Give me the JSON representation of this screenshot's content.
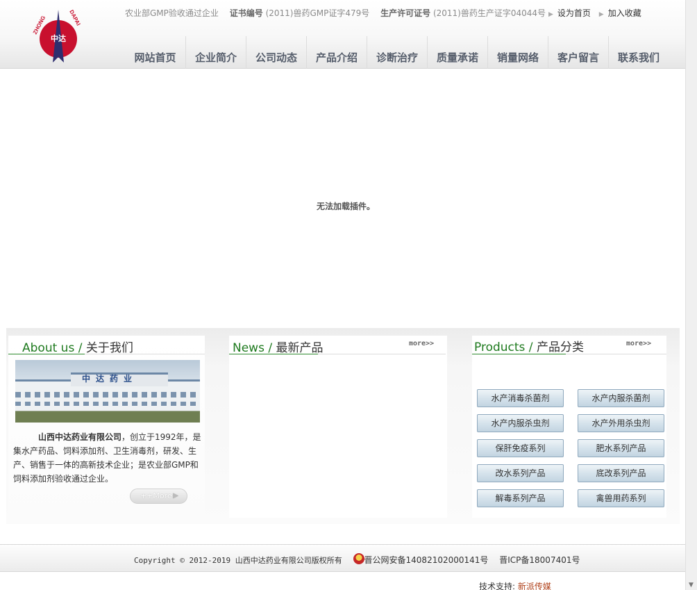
{
  "header": {
    "logo_letters": {
      "left": "ZHONG",
      "right": "DAPAI",
      "center": "中达"
    },
    "qualification": "农业部GMP验收通过企业",
    "cert_label": "证书编号",
    "cert_value": "(2011)兽药GMP证字479号",
    "license_label": "生产许可证号",
    "license_value": "(2011)兽药生产证字04044号",
    "set_home": "设为首页",
    "add_favorite": "加入收藏"
  },
  "nav": {
    "items": [
      "网站首页",
      "企业简介",
      "公司动态",
      "产品介绍",
      "诊断治疗",
      "质量承诺",
      "销量网络",
      "客户留言",
      "联系我们"
    ]
  },
  "plugin": {
    "message": "无法加载插件。"
  },
  "about": {
    "title_en": "About us /",
    "title_cn": "关于我们",
    "image_sign": "中达药业",
    "company_name": "山西中达药业有限公司",
    "description": "，创立于1992年，是集水产药品、饲料添加剂、卫生消毒剂，研发、生产、销售于一体的高新技术企业；是农业部GMP和饲料添加剂验收通过企业。",
    "more": "++More"
  },
  "news": {
    "title_en": "News /",
    "title_cn": "最新产品",
    "more": "more>>"
  },
  "products": {
    "title_en": "Products /",
    "title_cn": "产品分类",
    "more": "more>>",
    "items": [
      "水产消毒杀菌剂",
      "水产内服杀菌剂",
      "水产内服杀虫剂",
      "水产外用杀虫剂",
      "保肝免疫系列",
      "肥水系列产品",
      "改水系列产品",
      "底改系列产品",
      "解毒系列产品",
      "禽兽用药系列"
    ]
  },
  "footer": {
    "copyright": "Copyright © 2012-2019 山西中达药业有限公司版权所有",
    "police": "晋公网安备14082102000141号",
    "icp": "晋ICP备18007401号",
    "tech_label": "技术支持:",
    "tech_link": "新派传媒"
  },
  "colors": {
    "accent_green": "#2c8a2c",
    "nav_text": "#555d6b",
    "logo_red": "#c8102e",
    "logo_navy": "#2e2e6e"
  }
}
